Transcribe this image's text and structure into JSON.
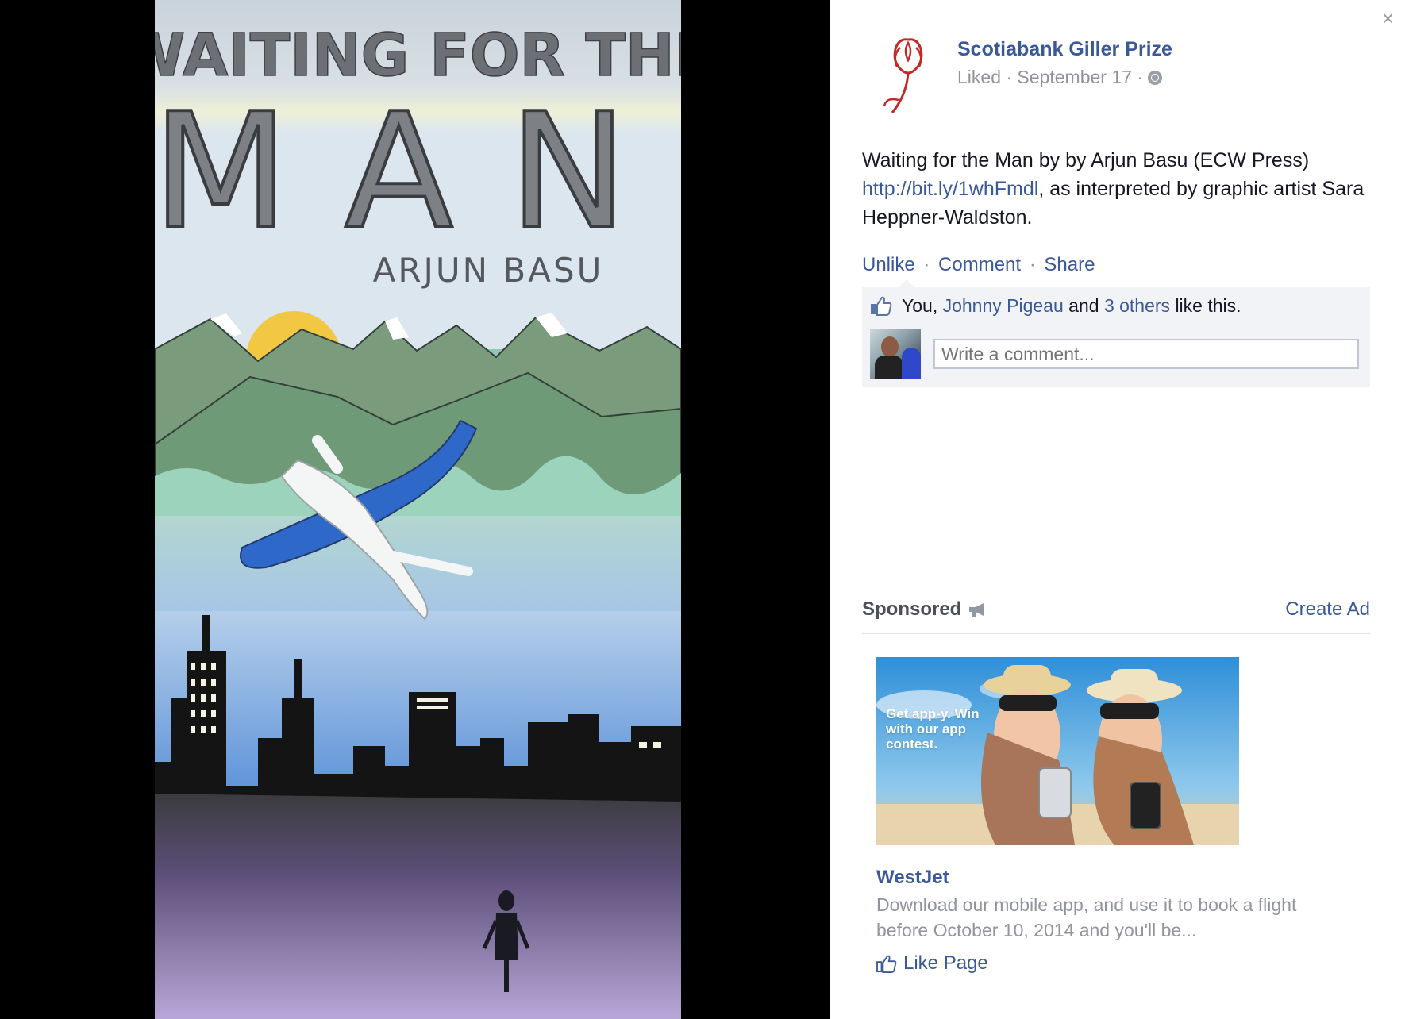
{
  "artwork": {
    "title_line1": "WAITING FOR THE",
    "title_line2": "MAN",
    "author": "ARJUN BASU"
  },
  "post": {
    "page_name": "Scotiabank Giller Prize",
    "meta": "Liked · September 17 ·",
    "text_before": "Waiting for the Man by by Arjun Basu (ECW Press) ",
    "link": "http://bit.ly/1whFmdl",
    "text_after": ", as interpreted by graphic artist Sara Heppner-Waldston."
  },
  "actions": {
    "unlike": "Unlike",
    "comment": "Comment",
    "share": "Share",
    "separator": "·"
  },
  "likes": {
    "you": "You,",
    "friend": "Johnny Pigeau",
    "and": "and",
    "others": "3 others",
    "suffix": "like this."
  },
  "comment_box": {
    "placeholder": "Write a comment..."
  },
  "sponsored": {
    "label": "Sponsored",
    "create_ad": "Create Ad",
    "ad_image_text": "Get app-y. Win with our app contest.",
    "ad_title": "WestJet",
    "ad_description": "Download our mobile app, and use it to book a flight before October 10, 2014 and you'll be...",
    "like_page": "Like Page"
  },
  "close_symbol": "×",
  "colors": {
    "link_blue": "#3b5998",
    "gray_text": "#90949c",
    "ufi_bg": "#f2f3f6"
  }
}
